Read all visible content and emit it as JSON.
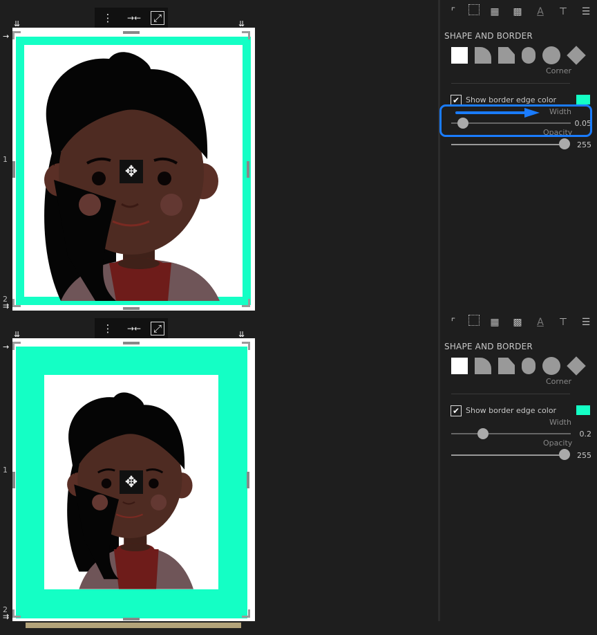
{
  "toolbar": {
    "menu_icon": "⋮",
    "fit_icon": "→←",
    "fill_icon": "⤢",
    "move_icon": "✥"
  },
  "ruler": {
    "mark_1": "1",
    "mark_2": "2"
  },
  "tabs": [
    {
      "icon": "crop-icon"
    },
    {
      "icon": "select-icon"
    },
    {
      "icon": "filmstrip-icon"
    },
    {
      "icon": "texture-icon"
    },
    {
      "icon": "text-icon",
      "glyph": "A"
    },
    {
      "icon": "paint-roller-icon"
    },
    {
      "icon": "sliders-icon"
    }
  ],
  "panel_top": {
    "section_title": "SHAPE AND BORDER",
    "corner_label": "Corner",
    "show_border_label": "Show border edge color",
    "width_label": "Width",
    "width_value": "0.05",
    "opacity_label": "Opacity",
    "opacity_value": "255",
    "border_color": "#14ffc5",
    "width_fraction": 0.05,
    "opacity_fraction": 1.0
  },
  "panel_bottom": {
    "section_title": "SHAPE AND BORDER",
    "corner_label": "Corner",
    "show_border_label": "Show border edge color",
    "width_label": "Width",
    "width_value": "0.2",
    "opacity_label": "Opacity",
    "opacity_value": "255",
    "border_color": "#14ffc5",
    "width_fraction": 0.2,
    "opacity_fraction": 1.0
  },
  "colors": {
    "border": "#14ffc5",
    "highlight": "#1a7cff",
    "skin": "#4e2b22",
    "hair": "#050505",
    "shirt": "#6e1c1a"
  }
}
